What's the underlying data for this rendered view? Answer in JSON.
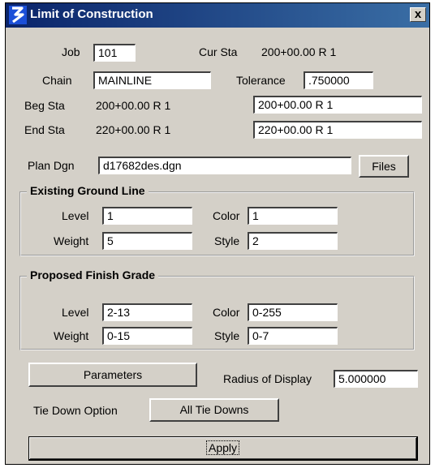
{
  "window": {
    "title": "Limit of Construction",
    "close_label": "x"
  },
  "header": {
    "job_label": "Job",
    "job_value": "101",
    "cur_sta_label": "Cur Sta",
    "cur_sta_value": "200+00.00 R 1",
    "chain_label": "Chain",
    "chain_value": "MAINLINE",
    "tolerance_label": "Tolerance",
    "tolerance_value": ".750000",
    "beg_sta_label": "Beg Sta",
    "beg_sta_value": "200+00.00 R 1",
    "beg_sta_field": "200+00.00 R 1",
    "end_sta_label": "End Sta",
    "end_sta_value": "220+00.00 R 1",
    "end_sta_field": "220+00.00 R 1"
  },
  "plan": {
    "label": "Plan Dgn",
    "value": "d17682des.dgn",
    "files_button": "Files"
  },
  "existing": {
    "title": "Existing Ground Line",
    "level_label": "Level",
    "level_value": "1",
    "color_label": "Color",
    "color_value": "1",
    "weight_label": "Weight",
    "weight_value": "5",
    "style_label": "Style",
    "style_value": "2"
  },
  "proposed": {
    "title": "Proposed Finish Grade",
    "level_label": "Level",
    "level_value": "2-13",
    "color_label": "Color",
    "color_value": "0-255",
    "weight_label": "Weight",
    "weight_value": "0-15",
    "style_label": "Style",
    "style_value": "0-7"
  },
  "bottom": {
    "parameters_button": "Parameters",
    "radius_label": "Radius of Display",
    "radius_value": "5.000000",
    "tie_down_label": "Tie Down Option",
    "tie_down_value": "All Tie Downs",
    "apply_button": "Apply"
  },
  "colors": {
    "title_bar_start": "#0a246a",
    "title_bar_end": "#3a6ea5",
    "dialog_face": "#d4d0c8"
  }
}
